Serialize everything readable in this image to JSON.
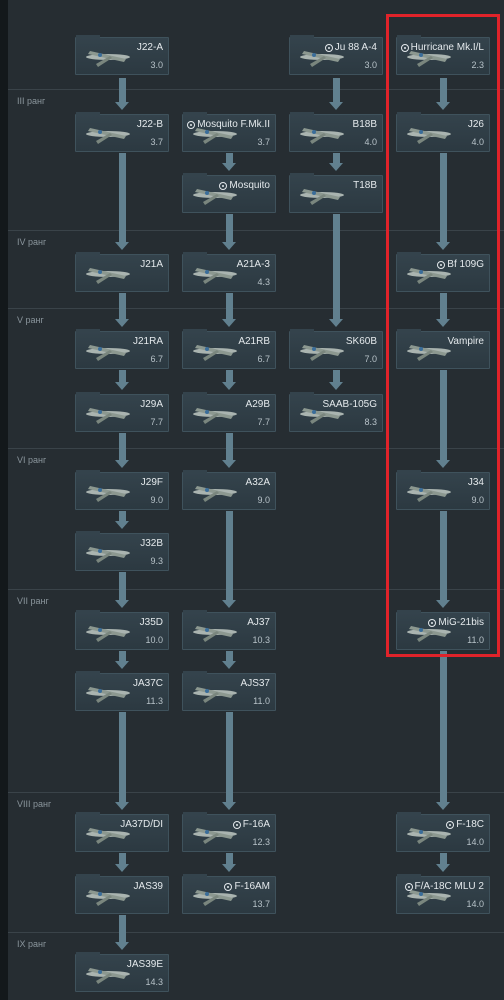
{
  "ranks": [
    {
      "id": "iii",
      "label": "III ранг"
    },
    {
      "id": "iv",
      "label": "IV ранг"
    },
    {
      "id": "v",
      "label": "V ранг"
    },
    {
      "id": "vi",
      "label": "VI ранг"
    },
    {
      "id": "vii",
      "label": "VII ранг"
    },
    {
      "id": "viii",
      "label": "VIII ранг"
    },
    {
      "id": "ix",
      "label": "IX ранг"
    }
  ],
  "vehicles": {
    "j22a": {
      "name": "J22-A",
      "br": "3.0",
      "premium": false
    },
    "ju88": {
      "name": "Ju 88 A-4",
      "br": "3.0",
      "premium": true
    },
    "hurricane": {
      "name": "Hurricane Mk.I/L",
      "br": "2.3",
      "premium": true
    },
    "j22b": {
      "name": "J22-B",
      "br": "3.7",
      "premium": false
    },
    "mosquito_fmk": {
      "name": "Mosquito F.Mk.II",
      "br": "3.7",
      "premium": true
    },
    "b18b": {
      "name": "B18B",
      "br": "4.0",
      "premium": false
    },
    "j26": {
      "name": "J26",
      "br": "4.0",
      "premium": false
    },
    "mosquito": {
      "name": "Mosquito",
      "br": "",
      "premium": true
    },
    "t18b": {
      "name": "T18B",
      "br": "",
      "premium": false
    },
    "j21a": {
      "name": "J21A",
      "br": "",
      "premium": false
    },
    "a21a3": {
      "name": "A21A-3",
      "br": "4.3",
      "premium": false
    },
    "bf109g": {
      "name": "Bf 109G",
      "br": "",
      "premium": true
    },
    "j21ra": {
      "name": "J21RA",
      "br": "6.7",
      "premium": false
    },
    "a21rb": {
      "name": "A21RB",
      "br": "6.7",
      "premium": false
    },
    "sk60b": {
      "name": "SK60B",
      "br": "7.0",
      "premium": false
    },
    "vampire": {
      "name": "Vampire",
      "br": "",
      "premium": false
    },
    "j29a": {
      "name": "J29A",
      "br": "7.7",
      "premium": false
    },
    "a29b": {
      "name": "A29B",
      "br": "7.7",
      "premium": false
    },
    "saab105g": {
      "name": "SAAB-105G",
      "br": "8.3",
      "premium": false
    },
    "j29f": {
      "name": "J29F",
      "br": "9.0",
      "premium": false
    },
    "a32a": {
      "name": "A32A",
      "br": "9.0",
      "premium": false
    },
    "j34": {
      "name": "J34",
      "br": "9.0",
      "premium": false
    },
    "j32b": {
      "name": "J32B",
      "br": "9.3",
      "premium": false
    },
    "j35d": {
      "name": "J35D",
      "br": "10.0",
      "premium": false
    },
    "aj37": {
      "name": "AJ37",
      "br": "10.3",
      "premium": false
    },
    "mig21": {
      "name": "MiG-21bis",
      "br": "11.0",
      "premium": true
    },
    "ja37c": {
      "name": "JA37C",
      "br": "11.3",
      "premium": false
    },
    "ajs37": {
      "name": "AJS37",
      "br": "11.0",
      "premium": false
    },
    "ja37d": {
      "name": "JA37D/DI",
      "br": "",
      "premium": false
    },
    "f16a": {
      "name": "F-16A",
      "br": "12.3",
      "premium": true
    },
    "f18c": {
      "name": "F-18C",
      "br": "14.0",
      "premium": true
    },
    "jas39": {
      "name": "JAS39",
      "br": "",
      "premium": false
    },
    "f16am": {
      "name": "F-16AM",
      "br": "13.7",
      "premium": true
    },
    "fa18c": {
      "name": "F/A-18C MLU 2",
      "br": "14.0",
      "premium": true
    },
    "jas39e": {
      "name": "JAS39E",
      "br": "14.3",
      "premium": false
    }
  },
  "colors": {
    "highlight": "#e0232a",
    "connector": "#61808f",
    "card": "#34434c"
  }
}
